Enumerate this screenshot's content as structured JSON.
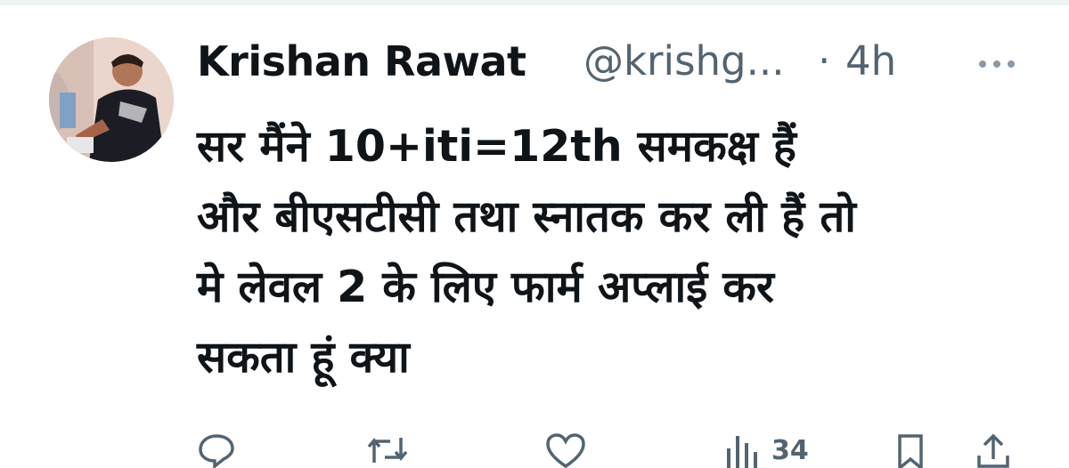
{
  "tweet": {
    "author_name": "Krishan Rawat",
    "handle": "@krishg...",
    "separator": "·",
    "time": "4h",
    "lines": [
      "सर मैंने 10+iti=12th समकक्ष हैं",
      "और बीएसटीसी तथा स्नातक कर ली हैं तो",
      "मे लेवल 2 के लिए फार्म अप्लाई कर",
      "सकता हूं क्या"
    ]
  },
  "actions": {
    "views_count": "34",
    "icons": [
      "reply-icon",
      "retweet-icon",
      "like-icon",
      "views-icon",
      "bookmark-icon",
      "share-icon"
    ]
  },
  "colors": {
    "text": "#0f1419",
    "secondary": "#536471",
    "divider": "#eff3f4"
  }
}
